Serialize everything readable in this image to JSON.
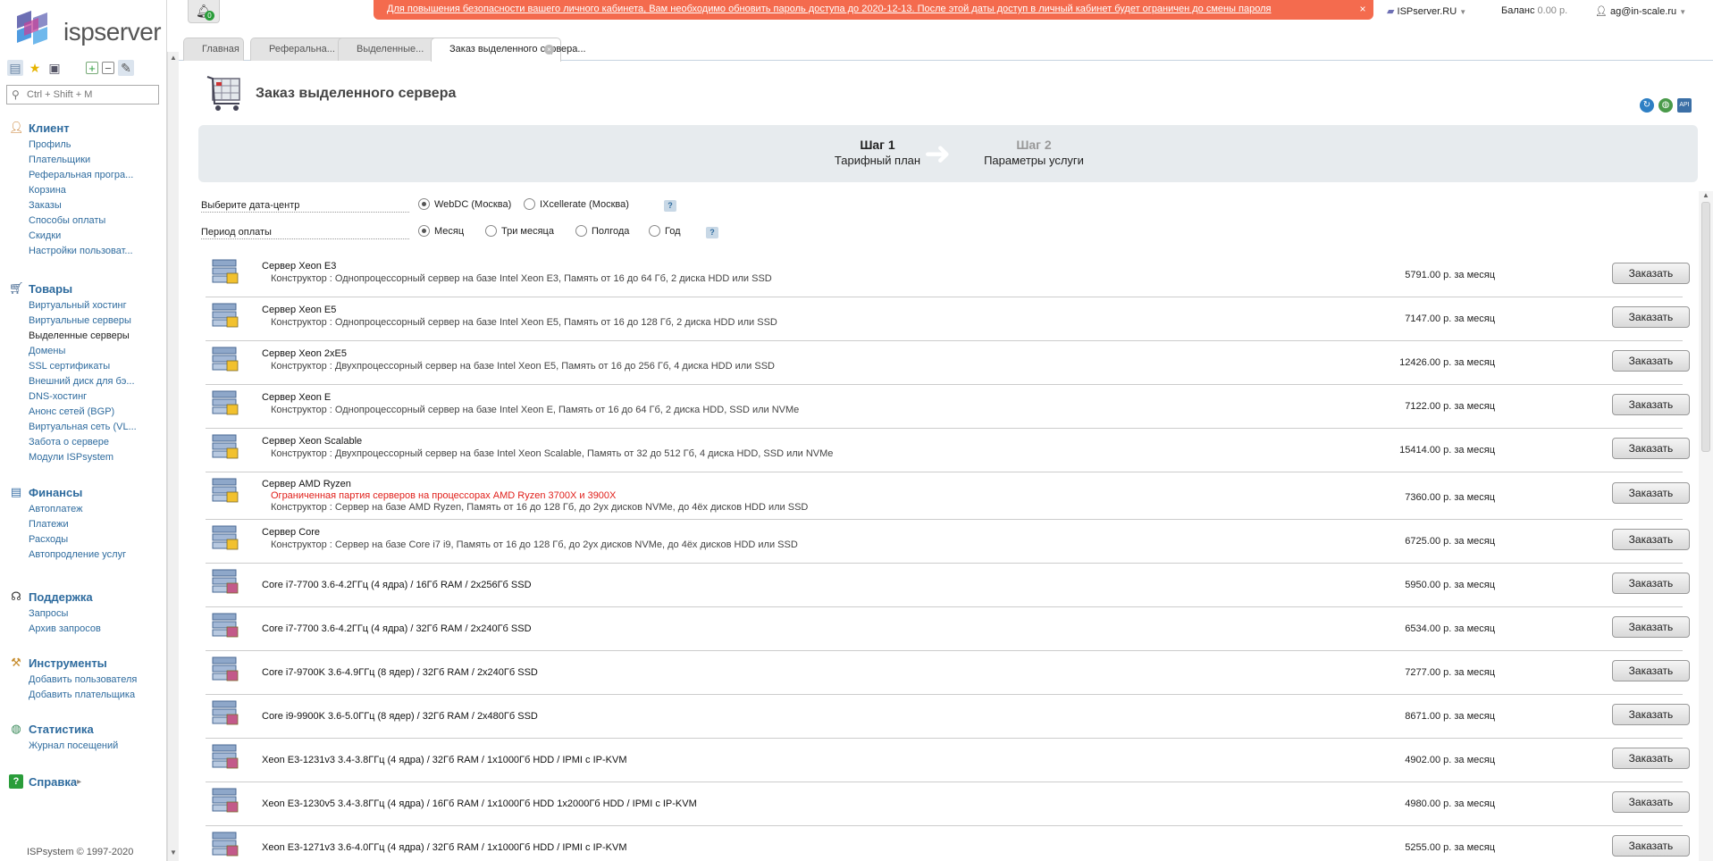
{
  "app": {
    "logo_text": "ispserver",
    "search_placeholder": "Ctrl + Shift + M",
    "footer": "ISPsystem © 1997-2020"
  },
  "sidebar": {
    "groups": [
      {
        "title": "Клиент",
        "icon": "user-icon",
        "items": [
          "Профиль",
          "Плательщики",
          "Реферальная програ...",
          "Корзина",
          "Заказы",
          "Способы оплаты",
          "Скидки",
          "Настройки пользоват..."
        ]
      },
      {
        "title": "Товары",
        "icon": "cart-icon",
        "items": [
          "Виртуальный хостинг",
          "Виртуальные серверы",
          "Выделенные серверы",
          "Домены",
          "SSL сертификаты",
          "Внешний диск для бэ...",
          "DNS-хостинг",
          "Анонс сетей (BGP)",
          "Виртуальная сеть (VL...",
          "Забота о сервере",
          "Модули ISPsystem"
        ]
      },
      {
        "title": "Финансы",
        "icon": "finance-icon",
        "items": [
          "Автоплатеж",
          "Платежи",
          "Расходы",
          "Автопродление услуг"
        ]
      },
      {
        "title": "Поддержка",
        "icon": "headset-icon",
        "items": [
          "Запросы",
          "Архив запросов"
        ]
      },
      {
        "title": "Инструменты",
        "icon": "tools-icon",
        "items": [
          "Добавить пользователя",
          "Добавить плательщика"
        ]
      },
      {
        "title": "Статистика",
        "icon": "globe-icon",
        "items": [
          "Журнал посещений"
        ]
      },
      {
        "title": "Справка",
        "icon": "help-icon",
        "items": []
      }
    ],
    "active_item": "Выделенные серверы"
  },
  "topbar": {
    "notifications_count": "0",
    "banner": "Для повышения безопасности вашего личного кабинета, Вам необходимо обновить пароль доступа до 2020-12-13. После этой даты доступ в личный кабинет будет ограничен до смены пароля",
    "provider": "ISPserver.RU",
    "balance_label": "Баланс",
    "balance_value": "0.00 р.",
    "user": "ag@in-scale.ru"
  },
  "tabs": [
    {
      "label": "Главная",
      "closable": false
    },
    {
      "label": "Реферальна...",
      "closable": true
    },
    {
      "label": "Выделенные...",
      "closable": true
    },
    {
      "label": "Заказ выделенного сервера...",
      "closable": true,
      "active": true
    }
  ],
  "page": {
    "title": "Заказ выделенного сервера",
    "steps": [
      {
        "num": "Шаг 1",
        "name": "Тарифный план"
      },
      {
        "num": "Шаг 2",
        "name": "Параметры услуги"
      }
    ],
    "datacenter": {
      "label": "Выберите дата-центр",
      "options": [
        "WebDC (Москва)",
        "IXcellerate (Москва)"
      ],
      "selected": 0
    },
    "period": {
      "label": "Период оплаты",
      "options": [
        "Месяц",
        "Три месяца",
        "Полгода",
        "Год"
      ],
      "selected": 0
    },
    "help_glyph": "?",
    "order_label": "Заказать"
  },
  "products": [
    {
      "name": "Сервер Xeon E3",
      "desc": "Конструктор : Однопроцессорный сервер на базе Intel Xeon E3, Память от 16 до 64 Гб, 2 диска HDD или SSD",
      "price": "5791.00 р. за месяц"
    },
    {
      "name": "Сервер Xeon E5",
      "desc": "Конструктор : Однопроцессорный сервер на базе Intel Xeon E5, Память от 16 до 128 Гб, 2 диска HDD или SSD",
      "price": "7147.00 р. за месяц"
    },
    {
      "name": "Сервер Xeon 2xE5",
      "desc": "Конструктор : Двухпроцессорный сервер на базе Intel Xeon E5, Память от 16 до 256 Гб, 4 диска HDD или SSD",
      "price": "12426.00 р. за месяц"
    },
    {
      "name": "Сервер Xeon E",
      "desc": "Конструктор : Однопроцессорный сервер на базе Intel Xeon E, Память от 16 до 64 Гб, 2 диска HDD, SSD или NVMe",
      "price": "7122.00 р. за месяц"
    },
    {
      "name": "Сервер Xeon Scalable",
      "desc": "Конструктор : Двухпроцессорный сервер на базе Intel Xeon Scalable, Память от 32 до 512 Гб, 4 диска HDD, SSD или NVMe",
      "price": "15414.00 р. за месяц"
    },
    {
      "name": "Сервер AMD Ryzen",
      "warn": "Ограниченная партия серверов на процессорах AMD Ryzen 3700X и 3900X",
      "desc": "Конструктор : Сервер на базе AMD Ryzen, Память от 16 до 128 Гб, до 2ух дисков NVMe, до 4ёх дисков HDD или SSD",
      "price": "7360.00 р. за месяц"
    },
    {
      "name": "Сервер Core",
      "desc": "Конструктор : Сервер на базе Core i7 i9, Память от 16 до 128 Гб, до 2ух дисков NVMe, до 4ёх дисков HDD или SSD",
      "price": "6725.00 р. за месяц"
    },
    {
      "name": "Core i7-7700 3.6-4.2ГГц (4 ядра) / 16Гб RAM / 2x256Гб SSD",
      "price": "5950.00 р. за месяц"
    },
    {
      "name": "Core i7-7700 3.6-4.2ГГц (4 ядра) / 32Гб RAM / 2x240Гб SSD",
      "price": "6534.00 р. за месяц"
    },
    {
      "name": "Core i7-9700K 3.6-4.9ГГц (8 ядер) / 32Гб RAM / 2x240Гб SSD",
      "price": "7277.00 р. за месяц"
    },
    {
      "name": "Core i9-9900K 3.6-5.0ГГц (8 ядер) / 32Гб RAM / 2x480Гб SSD",
      "price": "8671.00 р. за месяц"
    },
    {
      "name": "Xeon E3-1231v3 3.4-3.8ГГц (4 ядра) / 32Гб RAM / 1x1000Гб HDD / IPMI с IP-KVM",
      "price": "4902.00 р. за месяц"
    },
    {
      "name": "Xeon E3-1230v5 3.4-3.8ГГц (4 ядра) / 16Гб RAM / 1x1000Гб HDD 1x2000Гб HDD / IPMI с IP-KVM",
      "price": "4980.00 р. за месяц"
    },
    {
      "name": "Xeon E3-1271v3 3.6-4.0ГГц (4 ядра) / 32Гб RAM / 1x1000Гб HDD / IPMI с IP-KVM",
      "price": "5255.00 р. за месяц"
    }
  ],
  "colors": {
    "banner": "#f46b4e",
    "link": "#2e6b9e",
    "warning": "#e0201b",
    "wizard_bg": "#e7ebee"
  }
}
